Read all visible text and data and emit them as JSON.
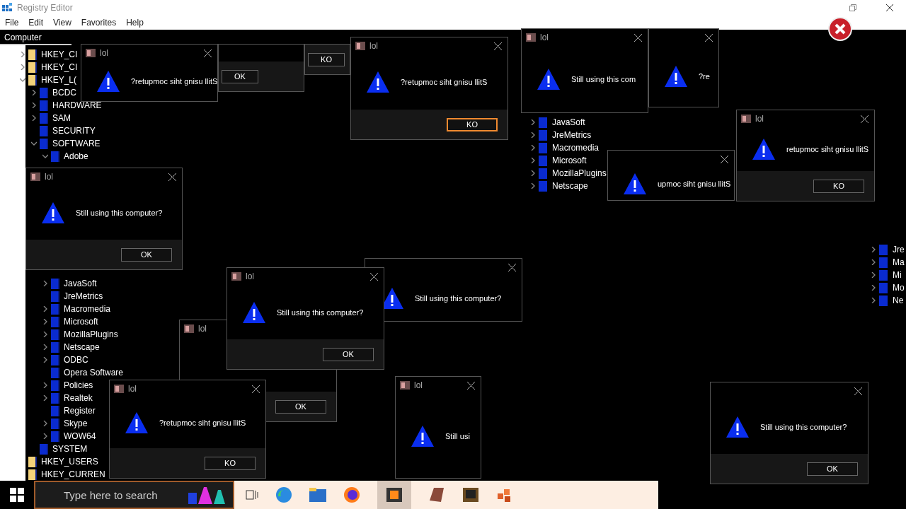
{
  "window": {
    "title": "Registry Editor",
    "menu": [
      "File",
      "Edit",
      "View",
      "Favorites",
      "Help"
    ]
  },
  "tree": {
    "header": "Computer",
    "items": [
      {
        "label": "HKEY_CI",
        "expanded": false
      },
      {
        "label": "HKEY_CI",
        "expanded": false
      },
      {
        "label": "HKEY_L(",
        "expanded": true,
        "children": [
          {
            "label": "BCDC",
            "expanded": false
          },
          {
            "label": "HARDWARE",
            "expanded": false
          },
          {
            "label": "SAM",
            "expanded": false
          },
          {
            "label": "SECURITY"
          },
          {
            "label": "SOFTWARE",
            "expanded": true,
            "children": [
              {
                "label": "Adobe",
                "expanded": true
              },
              {
                "label": "JavaSoft",
                "expanded": false
              },
              {
                "label": "JreMetrics"
              },
              {
                "label": "Macromedia",
                "expanded": false
              },
              {
                "label": "Microsoft",
                "expanded": false
              },
              {
                "label": "MozillaPlugins",
                "expanded": false
              },
              {
                "label": "Netscape",
                "expanded": false
              },
              {
                "label": "ODBC",
                "expanded": false
              },
              {
                "label": "Opera Software"
              },
              {
                "label": "Policies",
                "expanded": false
              },
              {
                "label": "Realtek",
                "expanded": false
              },
              {
                "label": "Register"
              },
              {
                "label": "Skype",
                "expanded": false
              },
              {
                "label": "WOW64",
                "expanded": false
              }
            ]
          },
          {
            "label": "SYSTEM"
          }
        ]
      },
      {
        "label": "HKEY_USERS"
      },
      {
        "label": "HKEY_CURREN"
      }
    ]
  },
  "tree_fragments": [
    [
      "JavaSoft",
      "JreMetrics",
      "Macromedia",
      "Microsoft",
      "MozillaPlugins",
      "Netscape"
    ],
    [
      "Jre",
      "Ma",
      "Mi",
      "Mo",
      "Ne"
    ]
  ],
  "dialogs": [
    {
      "title": "lol",
      "message": "?retupmoc siht gnisu llitS"
    },
    {
      "button": "OK",
      "focused": false
    },
    {
      "button": "KO",
      "focused": false
    },
    {
      "title": "lol",
      "message": "?retupmoc siht gnisu llitS",
      "button": "KO",
      "focused": true
    },
    {
      "title": "lol",
      "message": "Still using this computer?",
      "button": "OK",
      "focused": false
    },
    {
      "title": "lol",
      "message": "Still using this com"
    },
    {
      "message": "?re"
    },
    {
      "message": "upmoc siht gnisu llitS"
    },
    {
      "title": "lol",
      "message": "retupmoc siht gnisu llitS",
      "button": "KO",
      "focused": false
    },
    {
      "message": "Still using this computer?"
    },
    {
      "title": "lol",
      "button": "OK",
      "focused": false
    },
    {
      "title": "lol",
      "message": "Still using this computer?",
      "button": "OK",
      "focused": false
    },
    {
      "title": "lol",
      "message": "?retupmoc siht gnisu llitS",
      "button": "KO",
      "focused": false
    },
    {
      "title": "lol",
      "message": "Still usi"
    },
    {
      "message": "Still using this computer?",
      "button": "OK",
      "focused": false
    }
  ],
  "taskbar": {
    "search": {
      "placeholder": "Type here to search"
    }
  }
}
